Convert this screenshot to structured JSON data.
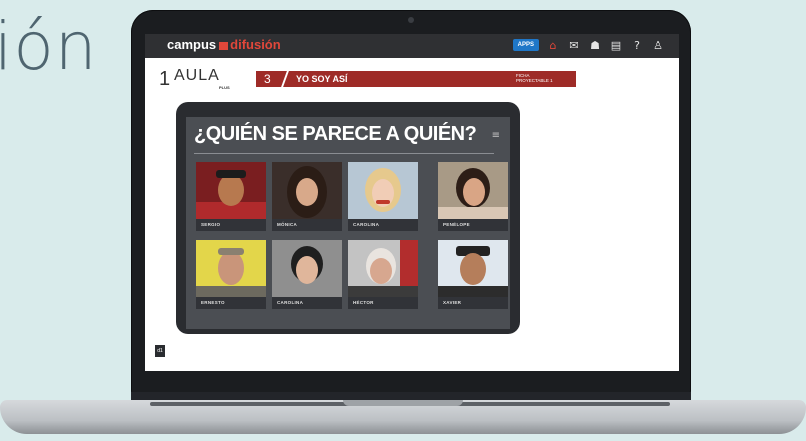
{
  "background_text": "ión",
  "app": {
    "logo_left": "campus",
    "logo_right": "difusión",
    "apps_label": "APPS",
    "icons": [
      "home-icon",
      "mail-icon",
      "group-icon",
      "book-icon",
      "help-icon",
      "user-icon"
    ],
    "colors": {
      "topbar": "#2f3033",
      "accent": "#e0473a",
      "unit_bar": "#9e2b27"
    }
  },
  "header": {
    "aula_number": "1",
    "aula_word": "AULA",
    "aula_plus": "PLUS",
    "unit_number": "3",
    "unit_title": "YO SOY ASÍ",
    "ficha_line1": "FICHA",
    "ficha_line2": "PROYECTABLE 1"
  },
  "tablet": {
    "title": "¿QUIÉN SE PARECE A QUIÉN?",
    "cards": [
      {
        "name": "SERGIO"
      },
      {
        "name": "MÓNICA"
      },
      {
        "name": "CAROLINA"
      },
      {
        "name": "PENÉLOPE"
      },
      {
        "name": "ERNESTO"
      },
      {
        "name": "CAROLINA"
      },
      {
        "name": "HÉCTOR"
      },
      {
        "name": "XAVIER"
      }
    ]
  },
  "footer": {
    "logo": "d1"
  }
}
